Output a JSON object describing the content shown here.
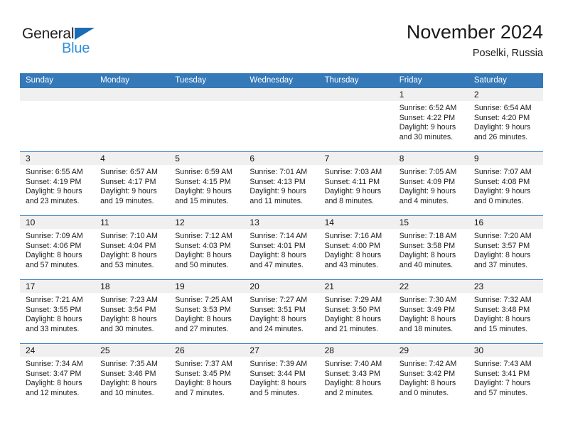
{
  "brand": {
    "name_part1": "General",
    "name_part2": "Blue",
    "triangle_color": "#1a6cb5",
    "blue_text_color": "#2f8fd8"
  },
  "header": {
    "title": "November 2024",
    "subtitle": "Poselki, Russia"
  },
  "theme": {
    "header_bar_color": "#3579b8",
    "day_band_color": "#f0f0f0",
    "row_border_color": "#3579b8"
  },
  "calendar": {
    "weekday_headers": [
      "Sunday",
      "Monday",
      "Tuesday",
      "Wednesday",
      "Thursday",
      "Friday",
      "Saturday"
    ],
    "weeks": [
      [
        {
          "date": "",
          "lines": []
        },
        {
          "date": "",
          "lines": []
        },
        {
          "date": "",
          "lines": []
        },
        {
          "date": "",
          "lines": []
        },
        {
          "date": "",
          "lines": []
        },
        {
          "date": "1",
          "lines": [
            "Sunrise: 6:52 AM",
            "Sunset: 4:22 PM",
            "Daylight: 9 hours",
            "and 30 minutes."
          ]
        },
        {
          "date": "2",
          "lines": [
            "Sunrise: 6:54 AM",
            "Sunset: 4:20 PM",
            "Daylight: 9 hours",
            "and 26 minutes."
          ]
        }
      ],
      [
        {
          "date": "3",
          "lines": [
            "Sunrise: 6:55 AM",
            "Sunset: 4:19 PM",
            "Daylight: 9 hours",
            "and 23 minutes."
          ]
        },
        {
          "date": "4",
          "lines": [
            "Sunrise: 6:57 AM",
            "Sunset: 4:17 PM",
            "Daylight: 9 hours",
            "and 19 minutes."
          ]
        },
        {
          "date": "5",
          "lines": [
            "Sunrise: 6:59 AM",
            "Sunset: 4:15 PM",
            "Daylight: 9 hours",
            "and 15 minutes."
          ]
        },
        {
          "date": "6",
          "lines": [
            "Sunrise: 7:01 AM",
            "Sunset: 4:13 PM",
            "Daylight: 9 hours",
            "and 11 minutes."
          ]
        },
        {
          "date": "7",
          "lines": [
            "Sunrise: 7:03 AM",
            "Sunset: 4:11 PM",
            "Daylight: 9 hours",
            "and 8 minutes."
          ]
        },
        {
          "date": "8",
          "lines": [
            "Sunrise: 7:05 AM",
            "Sunset: 4:09 PM",
            "Daylight: 9 hours",
            "and 4 minutes."
          ]
        },
        {
          "date": "9",
          "lines": [
            "Sunrise: 7:07 AM",
            "Sunset: 4:08 PM",
            "Daylight: 9 hours",
            "and 0 minutes."
          ]
        }
      ],
      [
        {
          "date": "10",
          "lines": [
            "Sunrise: 7:09 AM",
            "Sunset: 4:06 PM",
            "Daylight: 8 hours",
            "and 57 minutes."
          ]
        },
        {
          "date": "11",
          "lines": [
            "Sunrise: 7:10 AM",
            "Sunset: 4:04 PM",
            "Daylight: 8 hours",
            "and 53 minutes."
          ]
        },
        {
          "date": "12",
          "lines": [
            "Sunrise: 7:12 AM",
            "Sunset: 4:03 PM",
            "Daylight: 8 hours",
            "and 50 minutes."
          ]
        },
        {
          "date": "13",
          "lines": [
            "Sunrise: 7:14 AM",
            "Sunset: 4:01 PM",
            "Daylight: 8 hours",
            "and 47 minutes."
          ]
        },
        {
          "date": "14",
          "lines": [
            "Sunrise: 7:16 AM",
            "Sunset: 4:00 PM",
            "Daylight: 8 hours",
            "and 43 minutes."
          ]
        },
        {
          "date": "15",
          "lines": [
            "Sunrise: 7:18 AM",
            "Sunset: 3:58 PM",
            "Daylight: 8 hours",
            "and 40 minutes."
          ]
        },
        {
          "date": "16",
          "lines": [
            "Sunrise: 7:20 AM",
            "Sunset: 3:57 PM",
            "Daylight: 8 hours",
            "and 37 minutes."
          ]
        }
      ],
      [
        {
          "date": "17",
          "lines": [
            "Sunrise: 7:21 AM",
            "Sunset: 3:55 PM",
            "Daylight: 8 hours",
            "and 33 minutes."
          ]
        },
        {
          "date": "18",
          "lines": [
            "Sunrise: 7:23 AM",
            "Sunset: 3:54 PM",
            "Daylight: 8 hours",
            "and 30 minutes."
          ]
        },
        {
          "date": "19",
          "lines": [
            "Sunrise: 7:25 AM",
            "Sunset: 3:53 PM",
            "Daylight: 8 hours",
            "and 27 minutes."
          ]
        },
        {
          "date": "20",
          "lines": [
            "Sunrise: 7:27 AM",
            "Sunset: 3:51 PM",
            "Daylight: 8 hours",
            "and 24 minutes."
          ]
        },
        {
          "date": "21",
          "lines": [
            "Sunrise: 7:29 AM",
            "Sunset: 3:50 PM",
            "Daylight: 8 hours",
            "and 21 minutes."
          ]
        },
        {
          "date": "22",
          "lines": [
            "Sunrise: 7:30 AM",
            "Sunset: 3:49 PM",
            "Daylight: 8 hours",
            "and 18 minutes."
          ]
        },
        {
          "date": "23",
          "lines": [
            "Sunrise: 7:32 AM",
            "Sunset: 3:48 PM",
            "Daylight: 8 hours",
            "and 15 minutes."
          ]
        }
      ],
      [
        {
          "date": "24",
          "lines": [
            "Sunrise: 7:34 AM",
            "Sunset: 3:47 PM",
            "Daylight: 8 hours",
            "and 12 minutes."
          ]
        },
        {
          "date": "25",
          "lines": [
            "Sunrise: 7:35 AM",
            "Sunset: 3:46 PM",
            "Daylight: 8 hours",
            "and 10 minutes."
          ]
        },
        {
          "date": "26",
          "lines": [
            "Sunrise: 7:37 AM",
            "Sunset: 3:45 PM",
            "Daylight: 8 hours",
            "and 7 minutes."
          ]
        },
        {
          "date": "27",
          "lines": [
            "Sunrise: 7:39 AM",
            "Sunset: 3:44 PM",
            "Daylight: 8 hours",
            "and 5 minutes."
          ]
        },
        {
          "date": "28",
          "lines": [
            "Sunrise: 7:40 AM",
            "Sunset: 3:43 PM",
            "Daylight: 8 hours",
            "and 2 minutes."
          ]
        },
        {
          "date": "29",
          "lines": [
            "Sunrise: 7:42 AM",
            "Sunset: 3:42 PM",
            "Daylight: 8 hours",
            "and 0 minutes."
          ]
        },
        {
          "date": "30",
          "lines": [
            "Sunrise: 7:43 AM",
            "Sunset: 3:41 PM",
            "Daylight: 7 hours",
            "and 57 minutes."
          ]
        }
      ]
    ]
  }
}
